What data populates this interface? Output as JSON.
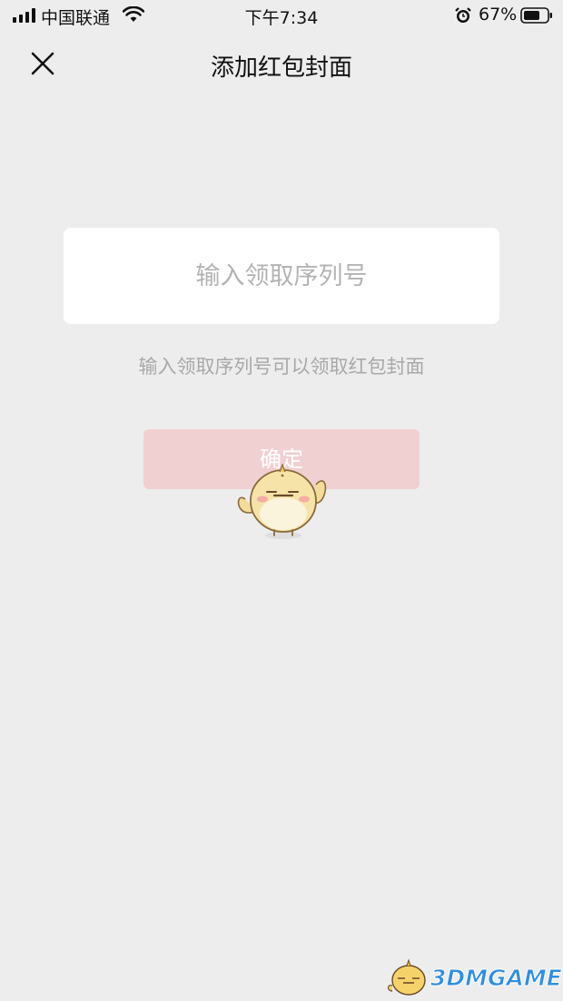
{
  "status_bar": {
    "carrier": "中国联通",
    "time": "下午7:34",
    "battery_percent": "67%",
    "icons": [
      "signal-icon",
      "wifi-icon",
      "alarm-icon",
      "battery-icon"
    ]
  },
  "nav": {
    "title": "添加红包封面",
    "close_icon": "close-icon"
  },
  "form": {
    "serial_placeholder": "输入领取序列号",
    "serial_value": "",
    "hint": "输入领取序列号可以领取红包封面",
    "confirm_label": "确定"
  },
  "watermark": {
    "text": "3DMGAME"
  },
  "colors": {
    "background": "#ededed",
    "input_background": "#ffffff",
    "button_disabled": "#f1d0d1",
    "hint_text": "#a8a8a8"
  }
}
